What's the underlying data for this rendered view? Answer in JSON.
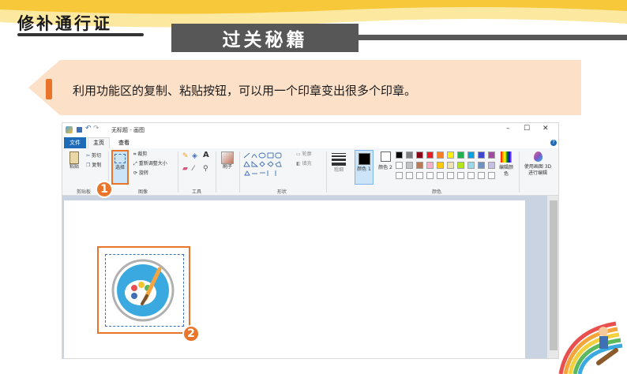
{
  "header": {
    "logo_text": "修补通行证",
    "title": "过关秘籍"
  },
  "banner": {
    "text": "利用功能区的复制、粘贴按钮，可以用一个印章变出很多个印章。"
  },
  "paint": {
    "window_title": "无标题 - 画图",
    "tabs": [
      "文件",
      "主页",
      "查看"
    ],
    "clipboard": {
      "paste": "粘贴",
      "cut": "剪切",
      "copy": "复制",
      "group": "剪贴板"
    },
    "image": {
      "select": "选择",
      "crop": "裁剪",
      "resize": "重新调整大小",
      "rotate": "旋转",
      "group": "图像"
    },
    "tools": {
      "group": "工具"
    },
    "brush": {
      "label": "刷子"
    },
    "shapes": {
      "outline": "轮廓",
      "fill": "填充",
      "group": "形状"
    },
    "size": {
      "label": "粗细"
    },
    "color1": {
      "label": "颜色 1"
    },
    "color2": {
      "label": "颜色 2"
    },
    "colors": {
      "group": "颜色",
      "edit": "编辑颜色",
      "paint3d": "使用画图 3D 进行编辑"
    },
    "win_controls": {
      "minimize": "–",
      "maximize": "☐",
      "close": "✕"
    },
    "palette": [
      "#000000",
      "#7f7f7f",
      "#880015",
      "#ed1c24",
      "#ff7f27",
      "#fff200",
      "#22b14c",
      "#00a2e8",
      "#3f48cc",
      "#a349a4",
      "#ffffff",
      "#c3c3c3",
      "#b97a57",
      "#ffaec9",
      "#ffc90e",
      "#efe4b0",
      "#b5e61d",
      "#99d9ea",
      "#7092be",
      "#c8bfe7"
    ]
  },
  "callouts": {
    "one": "1",
    "two": "2"
  },
  "colors": {
    "accent": "#e8752a",
    "title_bg": "#575757",
    "banner": "#fce3cf",
    "ribbon_tab": "#1e6bb8"
  }
}
